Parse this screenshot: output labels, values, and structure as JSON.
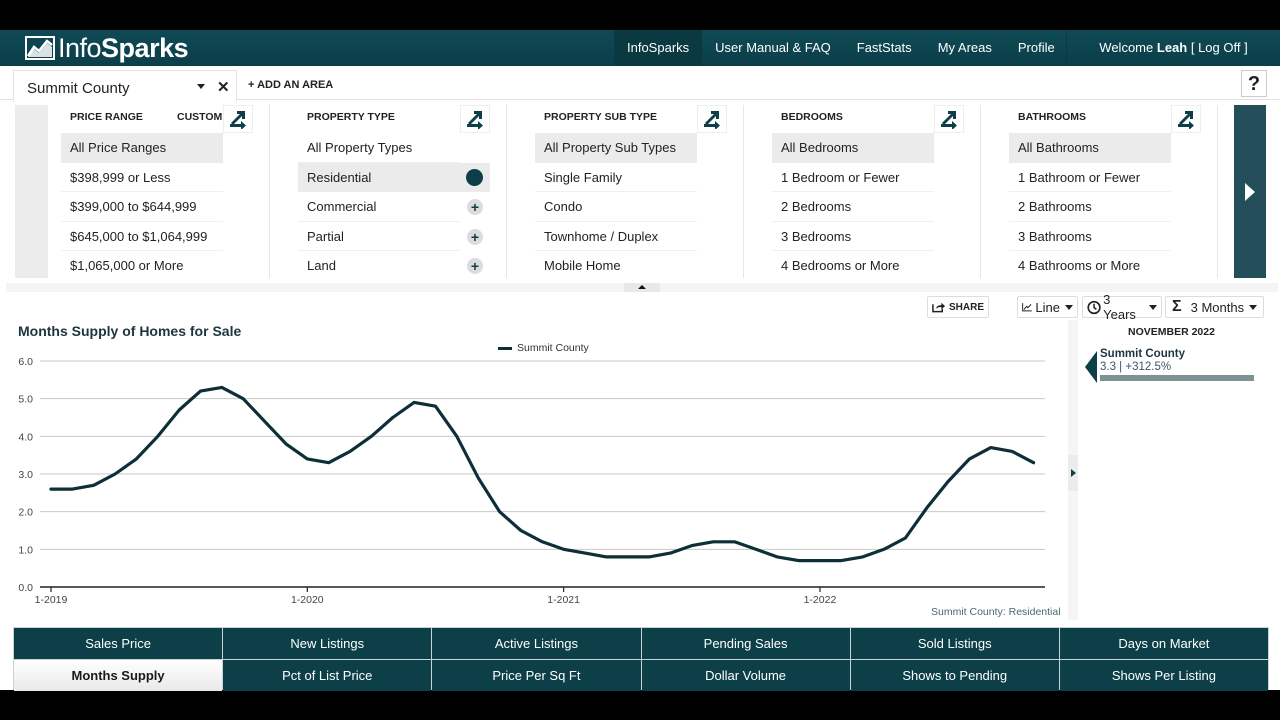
{
  "app": {
    "logo_light": "Info",
    "logo_bold": "Sparks"
  },
  "nav": {
    "items": [
      {
        "label": "InfoSparks",
        "active": true
      },
      {
        "label": "User Manual & FAQ"
      },
      {
        "label": "FastStats"
      },
      {
        "label": "My Areas"
      },
      {
        "label": "Profile"
      }
    ],
    "welcome_prefix": "Welcome",
    "username": "Leah",
    "logoff": "[ Log Off ]"
  },
  "area": {
    "selected": "Summit County",
    "add_label": "+ ADD AN AREA",
    "help_label": "?"
  },
  "filters": {
    "price_range": {
      "header": "PRICE RANGE",
      "custom_label": "CUSTOM",
      "options": [
        "All Price Ranges",
        "$398,999 or Less",
        "$399,000 to $644,999",
        "$645,000 to $1,064,999",
        "$1,065,000 or More"
      ],
      "selected": 0
    },
    "property_type": {
      "header": "PROPERTY TYPE",
      "options": [
        "All Property Types",
        "Residential",
        "Commercial",
        "Partial",
        "Land"
      ],
      "selected": 1
    },
    "property_sub_type": {
      "header": "PROPERTY SUB TYPE",
      "options": [
        "All Property Sub Types",
        "Single Family",
        "Condo",
        "Townhome / Duplex",
        "Mobile Home"
      ],
      "selected": 0
    },
    "bedrooms": {
      "header": "BEDROOMS",
      "options": [
        "All Bedrooms",
        "1 Bedroom or Fewer",
        "2 Bedrooms",
        "3 Bedrooms",
        "4 Bedrooms or More"
      ],
      "selected": 0
    },
    "bathrooms": {
      "header": "BATHROOMS",
      "options": [
        "All Bathrooms",
        "1 Bathroom or Fewer",
        "2 Bathrooms",
        "3 Bathrooms",
        "4 Bathrooms or More"
      ],
      "selected": 0
    }
  },
  "toolbar": {
    "share_label": "SHARE",
    "chart_type": "Line",
    "period": "3 Years",
    "rolling": "3 Months"
  },
  "sidepanel": {
    "date": "NOVEMBER 2022",
    "entries": [
      {
        "name": "Summit County",
        "value": "3.3 | +312.5%"
      }
    ]
  },
  "chart_footnote": "Summit County: Residential",
  "metric_tabs": [
    {
      "label": "Sales Price"
    },
    {
      "label": "New Listings"
    },
    {
      "label": "Active Listings"
    },
    {
      "label": "Pending Sales"
    },
    {
      "label": "Sold Listings"
    },
    {
      "label": "Days on Market"
    },
    {
      "label": "Months Supply",
      "active": true
    },
    {
      "label": "Pct of List Price"
    },
    {
      "label": "Price Per Sq Ft"
    },
    {
      "label": "Dollar Volume"
    },
    {
      "label": "Shows to Pending"
    },
    {
      "label": "Shows Per Listing"
    }
  ],
  "colors": {
    "brand": "#0d3f49",
    "line": "#0d2f37",
    "grid": "#c8c8c8"
  },
  "chart_data": {
    "type": "line",
    "title": "Months Supply of Homes for Sale",
    "xlabel": "",
    "ylabel": "",
    "ylim": [
      0,
      6
    ],
    "yticks": [
      "0.0",
      "1.0",
      "2.0",
      "3.0",
      "4.0",
      "5.0",
      "6.0"
    ],
    "xticks": [
      {
        "label": "1-2019",
        "index": 0
      },
      {
        "label": "1-2020",
        "index": 12
      },
      {
        "label": "1-2021",
        "index": 24
      },
      {
        "label": "1-2022",
        "index": 36
      }
    ],
    "grid": true,
    "legend": "top-center",
    "x": [
      "2019-01",
      "2019-02",
      "2019-03",
      "2019-04",
      "2019-05",
      "2019-06",
      "2019-07",
      "2019-08",
      "2019-09",
      "2019-10",
      "2019-11",
      "2019-12",
      "2020-01",
      "2020-02",
      "2020-03",
      "2020-04",
      "2020-05",
      "2020-06",
      "2020-07",
      "2020-08",
      "2020-09",
      "2020-10",
      "2020-11",
      "2020-12",
      "2021-01",
      "2021-02",
      "2021-03",
      "2021-04",
      "2021-05",
      "2021-06",
      "2021-07",
      "2021-08",
      "2021-09",
      "2021-10",
      "2021-11",
      "2021-12",
      "2022-01",
      "2022-02",
      "2022-03",
      "2022-04",
      "2022-05",
      "2022-06",
      "2022-07",
      "2022-08",
      "2022-09",
      "2022-10",
      "2022-11"
    ],
    "series": [
      {
        "name": "Summit County",
        "values": [
          2.6,
          2.6,
          2.7,
          3.0,
          3.4,
          4.0,
          4.7,
          5.2,
          5.3,
          5.0,
          4.4,
          3.8,
          3.4,
          3.3,
          3.6,
          4.0,
          4.5,
          4.9,
          4.8,
          4.0,
          2.9,
          2.0,
          1.5,
          1.2,
          1.0,
          0.9,
          0.8,
          0.8,
          0.8,
          0.9,
          1.1,
          1.2,
          1.2,
          1.0,
          0.8,
          0.7,
          0.7,
          0.7,
          0.8,
          1.0,
          1.3,
          2.1,
          2.8,
          3.4,
          3.7,
          3.6,
          3.3
        ]
      }
    ]
  }
}
